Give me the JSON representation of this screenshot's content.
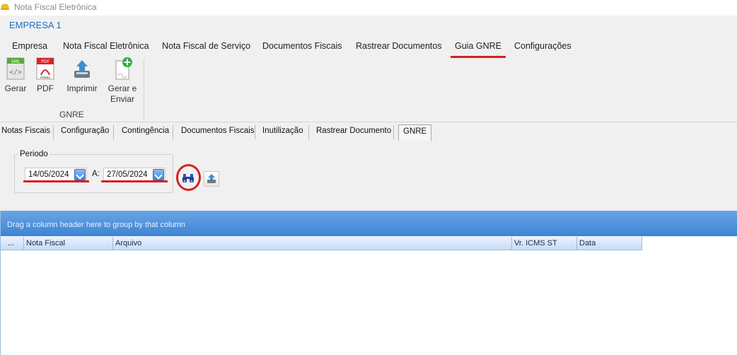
{
  "window": {
    "title": "Nota Fiscal Eletrônica",
    "app_icon": "hardhat-icon"
  },
  "company": {
    "name": "EMPRESA 1"
  },
  "ribbon_tabs": [
    {
      "label": "Empresa"
    },
    {
      "label": "Nota Fiscal Eletrônica"
    },
    {
      "label": "Nota Fiscal de Serviço"
    },
    {
      "label": "Documentos Fiscais"
    },
    {
      "label": "Rastrear Documentos"
    },
    {
      "label": "Guia GNRE",
      "active": true
    },
    {
      "label": "Configurações"
    }
  ],
  "ribbon_group": {
    "label": "GNRE",
    "buttons": [
      {
        "label": "Gerar",
        "icon": "xml-file-icon"
      },
      {
        "label": "PDF",
        "icon": "pdf-file-icon"
      },
      {
        "label": "Imprimir",
        "icon": "printer-icon"
      },
      {
        "label_line1": "Gerar e",
        "label_line2": "Enviar",
        "icon": "add-document-icon"
      }
    ]
  },
  "subtabs": [
    {
      "label": "Notas Fiscais"
    },
    {
      "label": "Configuração"
    },
    {
      "label": "Contingência"
    },
    {
      "label": "Documentos Fiscais"
    },
    {
      "label": "Inutilização"
    },
    {
      "label": "Rastrear Documento"
    },
    {
      "label": "GNRE",
      "active": true
    }
  ],
  "period": {
    "legend": "Periodo",
    "start_date": "14/05/2024",
    "separator": "A:",
    "end_date": "27/05/2024"
  },
  "grid": {
    "group_hint": "Drag a column header here to group by that column",
    "columns": [
      "...",
      "Nota Fiscal",
      "Arquivo",
      "Vr. ICMS ST",
      "Data"
    ],
    "rows": []
  },
  "colors": {
    "accent_red": "#d91e1e",
    "link_blue": "#1f6fbf",
    "grid_blue": "#3d84d4"
  }
}
